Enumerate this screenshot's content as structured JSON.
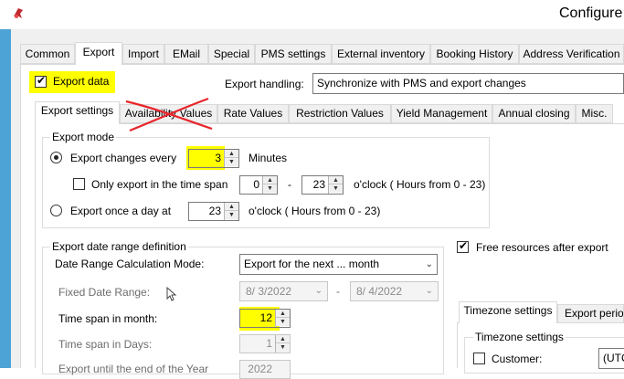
{
  "window": {
    "title": "Configure"
  },
  "main_tabs": [
    {
      "label": "Common"
    },
    {
      "label": "Export"
    },
    {
      "label": "Import"
    },
    {
      "label": "EMail"
    },
    {
      "label": "Special"
    },
    {
      "label": "PMS settings"
    },
    {
      "label": "External inventory"
    },
    {
      "label": "Booking History"
    },
    {
      "label": "Address Verification"
    }
  ],
  "export_tab": {
    "export_data_label": "Export data",
    "export_data_checked": true,
    "export_handling_label": "Export handling:",
    "export_handling_value": "Synchronize with PMS and export changes"
  },
  "sub_tabs": [
    {
      "label": "Export settings"
    },
    {
      "label": "Availability Values"
    },
    {
      "label": "Rate Values"
    },
    {
      "label": "Restriction Values"
    },
    {
      "label": "Yield Management"
    },
    {
      "label": "Annual closing"
    },
    {
      "label": "Misc."
    }
  ],
  "export_mode": {
    "title": "Export mode",
    "changes_every_label": "Export changes every",
    "changes_every_value": "3",
    "minutes_label": "Minutes",
    "only_timespan_label": "Only export in the time span",
    "from_hour": "0",
    "dash": "-",
    "to_hour": "23",
    "hours_hint": "o'clock ( Hours from 0 - 23)",
    "once_a_day_label": "Export once a day at",
    "once_a_day_value": "23",
    "once_hours_hint": "o'clock ( Hours from 0 - 23)"
  },
  "date_range": {
    "title": "Export date range definition",
    "calc_mode_label": "Date Range Calculation Mode:",
    "calc_mode_value": "Export for the next ... month",
    "fixed_label": "Fixed Date Range:",
    "fixed_from": "8/  3/2022",
    "fixed_to": "8/  4/2022",
    "fixed_dash": "-",
    "span_month_label": "Time span in month:",
    "span_month_value": "12",
    "span_days_label": "Time span in Days:",
    "span_days_value": "1",
    "year_end_label": "Export until the end of the Year",
    "year_end_value": "2022"
  },
  "right_panel": {
    "free_resources_label": "Free resources after export",
    "free_resources_checked": true,
    "tz_tabs": [
      {
        "label": "Timezone settings"
      },
      {
        "label": "Export period"
      }
    ],
    "tz_group_title": "Timezone settings",
    "customer_label": "Customer:",
    "customer_value": "(UTC"
  },
  "colors": {
    "highlight": "#ffff00",
    "frame": "#4da3d6",
    "strike": "#e8242a"
  }
}
